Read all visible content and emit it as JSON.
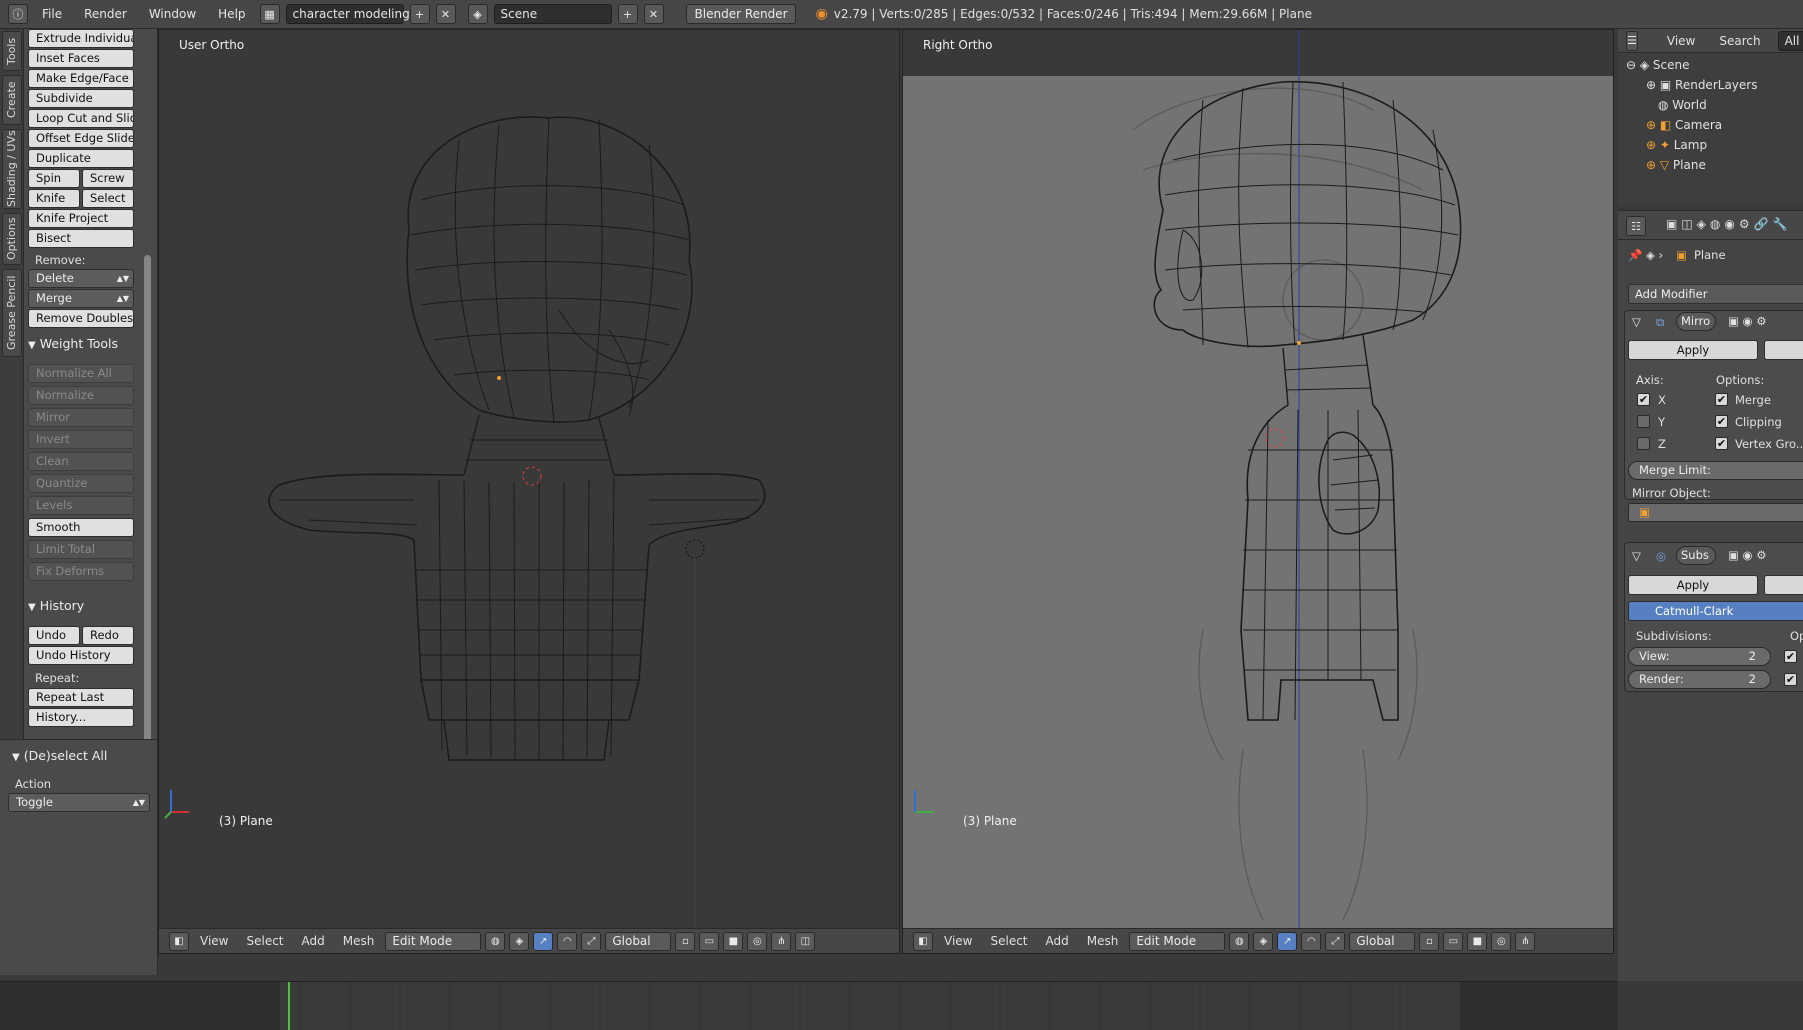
{
  "topbar": {
    "info_icon": "info-icon",
    "menus": [
      "File",
      "Render",
      "Window",
      "Help"
    ],
    "screen_layout": "character modeling",
    "scene": "Scene",
    "render_engine": "Blender Render",
    "stats": "v2.79 | Verts:0/285 | Edges:0/532 | Faces:0/246 | Tris:494 | Mem:29.66M | Plane"
  },
  "tabs": [
    "Tools",
    "Create",
    "Shading / UVs",
    "Options",
    "Grease Pencil"
  ],
  "tools": {
    "extrude_individual": "Extrude Individual",
    "inset_faces": "Inset Faces",
    "make_edge_face": "Make Edge/Face",
    "subdivide": "Subdivide",
    "loop_cut": "Loop Cut and Slide",
    "offset_edge": "Offset Edge Slide",
    "duplicate": "Duplicate",
    "spin": "Spin",
    "screw": "Screw",
    "knife": "Knife",
    "select": "Select",
    "knife_project": "Knife Project",
    "bisect": "Bisect",
    "remove_label": "Remove:",
    "delete": "Delete",
    "merge": "Merge",
    "remove_doubles": "Remove Doubles"
  },
  "weight_tools": {
    "title": "Weight Tools",
    "items": [
      "Normalize All",
      "Normalize",
      "Mirror",
      "Invert",
      "Clean",
      "Quantize",
      "Levels",
      "Smooth",
      "Limit Total",
      "Fix Deforms"
    ]
  },
  "history": {
    "title": "History",
    "undo": "Undo",
    "redo": "Redo",
    "undo_history": "Undo History",
    "repeat_label": "Repeat:",
    "repeat_last": "Repeat Last",
    "history_btn": "History..."
  },
  "operator": {
    "title": "(De)select All",
    "action_label": "Action",
    "action_value": "Toggle"
  },
  "viewport_left": {
    "label": "User Ortho",
    "object_label": "(3) Plane",
    "menus": [
      "View",
      "Select",
      "Add",
      "Mesh"
    ],
    "mode": "Edit Mode",
    "orientation": "Global"
  },
  "viewport_right": {
    "label": "Right Ortho",
    "object_label": "(3) Plane",
    "menus": [
      "View",
      "Select",
      "Add",
      "Mesh"
    ],
    "mode": "Edit Mode",
    "orientation": "Global"
  },
  "outliner": {
    "menus": [
      "View",
      "Search"
    ],
    "filter": "All Sc",
    "items": [
      "Scene",
      "RenderLayers",
      "World",
      "Camera",
      "Lamp",
      "Plane"
    ]
  },
  "properties": {
    "object_name": "Plane",
    "add_modifier": "Add Modifier",
    "mirror": {
      "name": "Mirro",
      "apply": "Apply",
      "axis_label": "Axis:",
      "options_label": "Options:",
      "axes": [
        {
          "label": "X",
          "checked": true
        },
        {
          "label": "Y",
          "checked": false
        },
        {
          "label": "Z",
          "checked": false
        }
      ],
      "options": [
        {
          "label": "Merge",
          "checked": true
        },
        {
          "label": "Clipping",
          "checked": true
        },
        {
          "label": "Vertex Gro...",
          "checked": true
        }
      ],
      "merge_limit": "Merge Limit:",
      "mirror_object": "Mirror Object:"
    },
    "subsurf": {
      "name": "Subs",
      "apply": "Apply",
      "mode": "Catmull-Clark",
      "subdivisions_label": "Subdivisions:",
      "options_label": "Opti",
      "view_label": "View:",
      "view_value": "2",
      "render_label": "Render:",
      "render_value": "2"
    }
  },
  "colors": {
    "accent": "#5680c2",
    "selection_orange": "#f0a030",
    "panel": "#4a4a4a",
    "viewport_dark": "#393939",
    "viewport_light": "#737373"
  }
}
